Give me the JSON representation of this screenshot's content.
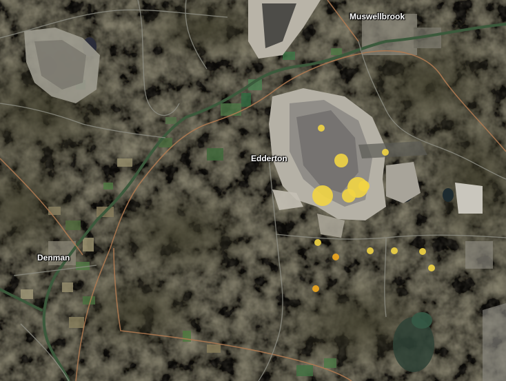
{
  "map": {
    "view": "satellite",
    "towns": [
      {
        "id": "muswellbrook",
        "label": "Muswellbrook"
      },
      {
        "id": "edderton",
        "label": "Edderton"
      },
      {
        "id": "denman",
        "label": "Denman"
      }
    ],
    "markers": [
      {
        "id": "m1",
        "size_class": "small",
        "color": "#f2d544"
      },
      {
        "id": "m2",
        "size_class": "small",
        "color": "#f2d544"
      },
      {
        "id": "m3",
        "size_class": "medium",
        "color": "#f2d544"
      },
      {
        "id": "m4",
        "size_class": "large",
        "color": "#f2d544"
      },
      {
        "id": "m5",
        "size_class": "large",
        "color": "#f2d544"
      },
      {
        "id": "m6",
        "size_class": "medium",
        "color": "#f2d544"
      },
      {
        "id": "m7",
        "size_class": "large",
        "color": "#f2d544"
      },
      {
        "id": "m8",
        "size_class": "small",
        "color": "#f2d544"
      },
      {
        "id": "m9",
        "size_class": "small",
        "color": "#f2a81e"
      },
      {
        "id": "m10",
        "size_class": "small",
        "color": "#f2d544"
      },
      {
        "id": "m11",
        "size_class": "small",
        "color": "#f2d544"
      },
      {
        "id": "m12",
        "size_class": "small",
        "color": "#f2d544"
      },
      {
        "id": "m13",
        "size_class": "small",
        "color": "#f2d544"
      },
      {
        "id": "m14",
        "size_class": "small",
        "color": "#f2a81e"
      }
    ],
    "colors": {
      "terrain": "#6e6549",
      "road": "#b07a52",
      "minor_road": "#8e8f86",
      "river": "#3c5a3c",
      "mine": "#b7b3a8",
      "water": "#2e3b33"
    }
  }
}
